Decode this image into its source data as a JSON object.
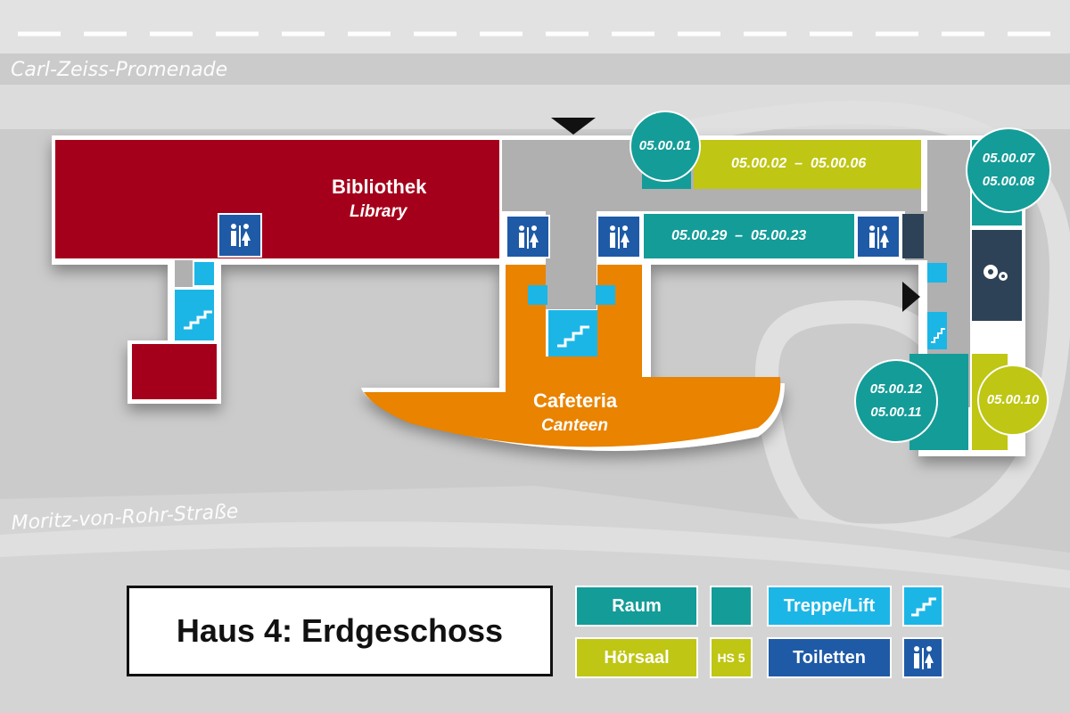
{
  "streets": {
    "top": "Carl-Zeiss-Promenade",
    "bottom": "Moritz-von-Rohr-Straße"
  },
  "rooms": {
    "library_de": "Bibliothek",
    "library_en": "Library",
    "cafeteria_de": "Cafeteria",
    "cafeteria_en": "Canteen",
    "r_050001": "05.00.01",
    "r_050002_06": "05.00.02  –  05.00.06",
    "r_050007": "05.00.07",
    "r_050008": "05.00.08",
    "r_050029_23": "05.00.29  –  05.00.23",
    "r_050012": "05.00.12",
    "r_050011": "05.00.11",
    "r_050010": "05.00.10"
  },
  "title": "Haus 4:  Erdgeschoss",
  "legend": {
    "raum": "Raum",
    "hoersaal": "Hörsaal",
    "hs5": "HS 5",
    "treppe": "Treppe/Lift",
    "toiletten": "Toiletten"
  },
  "colors": {
    "library": "#a5001b",
    "cafeteria": "#e98300",
    "room": "#149c98",
    "lecture": "#bfc613",
    "stairs": "#1cb6e6",
    "toilet": "#1f5aa6",
    "technical": "#2e4257",
    "corridor": "#b0b0b0",
    "road": "#e3e3e3"
  },
  "icons": [
    "toilet-icon",
    "stairs-icon",
    "gears-icon",
    "entrance-arrow-icon"
  ]
}
